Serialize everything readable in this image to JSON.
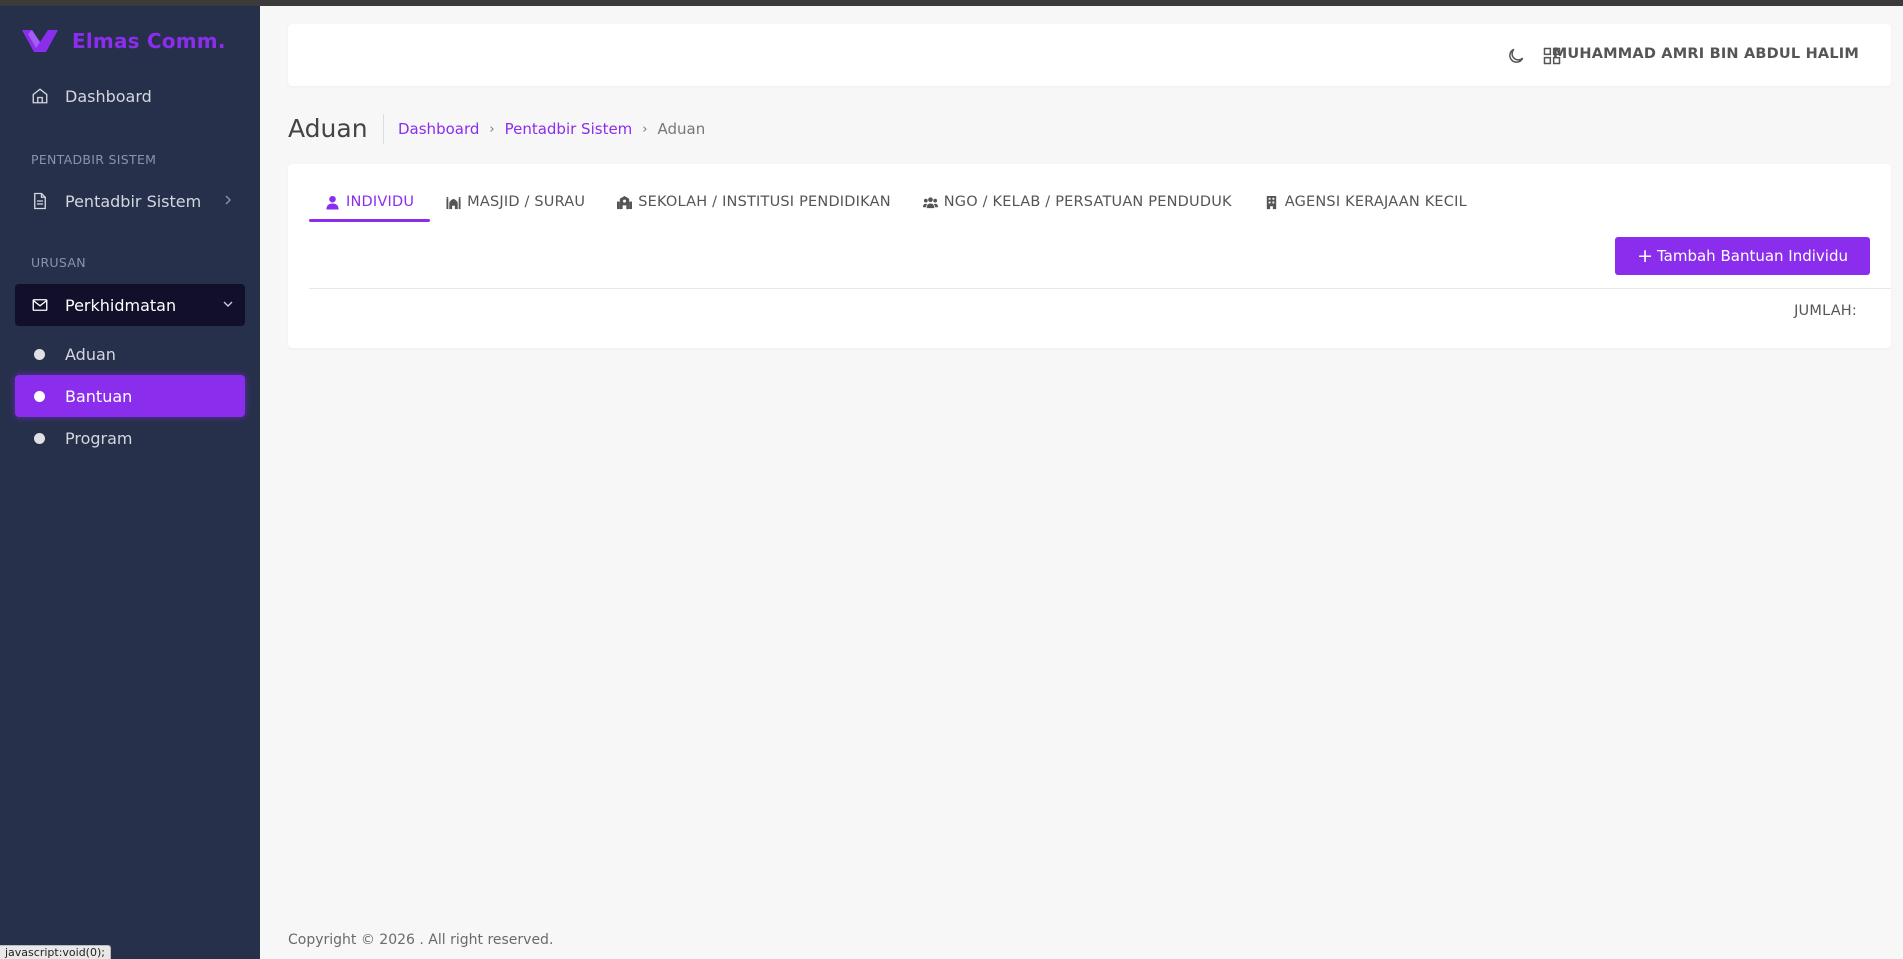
{
  "brand": {
    "name": "Elmas Comm."
  },
  "sidebar": {
    "dashboard": "Dashboard",
    "sections": {
      "admin": "PENTADBIR SISTEM",
      "urusan": "URUSAN"
    },
    "pentadbir": "Pentadbir Sistem",
    "perkhidmatan": "Perkhidmatan",
    "subitems": [
      "Aduan",
      "Bantuan",
      "Program"
    ],
    "active_subitem": "Bantuan"
  },
  "header": {
    "user_name": "MUHAMMAD AMRI BIN ABDUL HALIM",
    "icons": [
      "moon-icon",
      "apps-grid-icon"
    ]
  },
  "page": {
    "title": "Aduan",
    "breadcrumb": [
      "Dashboard",
      "Pentadbir Sistem",
      "Aduan"
    ]
  },
  "tabs": [
    {
      "label": "INDIVIDU",
      "icon": "user-icon",
      "active": true
    },
    {
      "label": "MASJID / SURAU",
      "icon": "mosque-icon",
      "active": false
    },
    {
      "label": "SEKOLAH / INSTITUSI PENDIDIKAN",
      "icon": "school-icon",
      "active": false
    },
    {
      "label": "NGO / KELAB / PERSATUAN PENDUDUK",
      "icon": "users-icon",
      "active": false
    },
    {
      "label": "AGENSI KERAJAAN KECIL",
      "icon": "building-icon",
      "active": false
    }
  ],
  "card": {
    "add_button": "Tambah Bantuan Individu",
    "total_label": "JUMLAH:"
  },
  "footer": {
    "text": "Copyright © 2026 . All right reserved."
  },
  "status_bar": {
    "text": "javascript:void(0);"
  },
  "colors": {
    "accent": "#8b2ded",
    "sidebar": "#26304a",
    "sidebar_active": "#120f2a",
    "page_bg": "#f7f7f7"
  }
}
